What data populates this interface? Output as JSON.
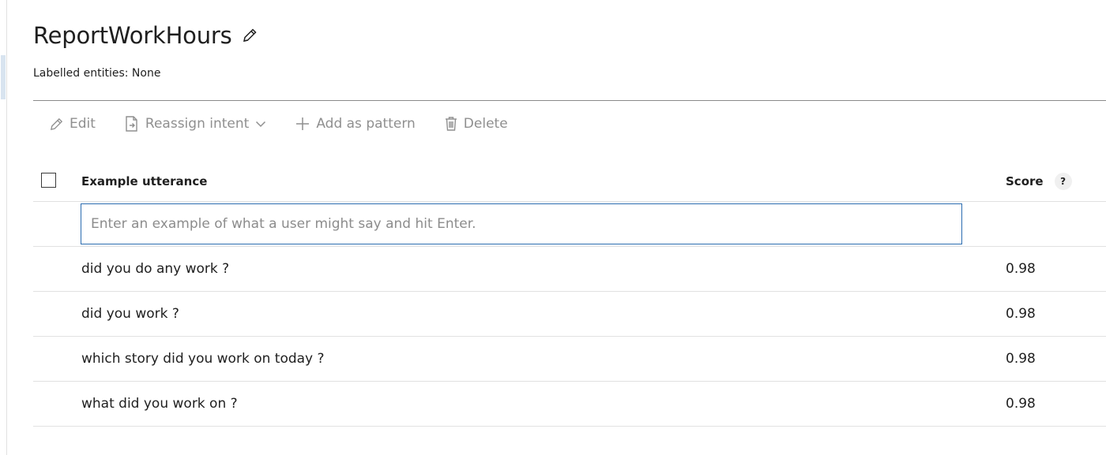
{
  "intent": {
    "title": "ReportWorkHours",
    "labelled_entities": "Labelled entities: None"
  },
  "toolbar": {
    "edit_label": "Edit",
    "reassign_label": "Reassign intent",
    "add_pattern_label": "Add as pattern",
    "delete_label": "Delete"
  },
  "table": {
    "col_utterance": "Example utterance",
    "col_score": "Score",
    "help_glyph": "?",
    "input_placeholder": "Enter an example of what a user might say and hit Enter.",
    "rows": [
      {
        "utterance": "did you do any work ?",
        "score": "0.98"
      },
      {
        "utterance": "did you work ?",
        "score": "0.98"
      },
      {
        "utterance": "which story did you work on today ?",
        "score": "0.98"
      },
      {
        "utterance": "what did you work on ?",
        "score": "0.98"
      }
    ]
  },
  "icons": {
    "title_edit": "pencil-icon",
    "edit": "pencil-icon",
    "reassign": "document-arrow-icon",
    "reassign_dropdown": "chevron-down-icon",
    "add_pattern": "plus-icon",
    "delete": "trash-icon"
  },
  "colors": {
    "input_border": "#2b6cb0",
    "toolbar_disabled": "#8f8f8f",
    "row_divider": "#e1e1e1"
  }
}
